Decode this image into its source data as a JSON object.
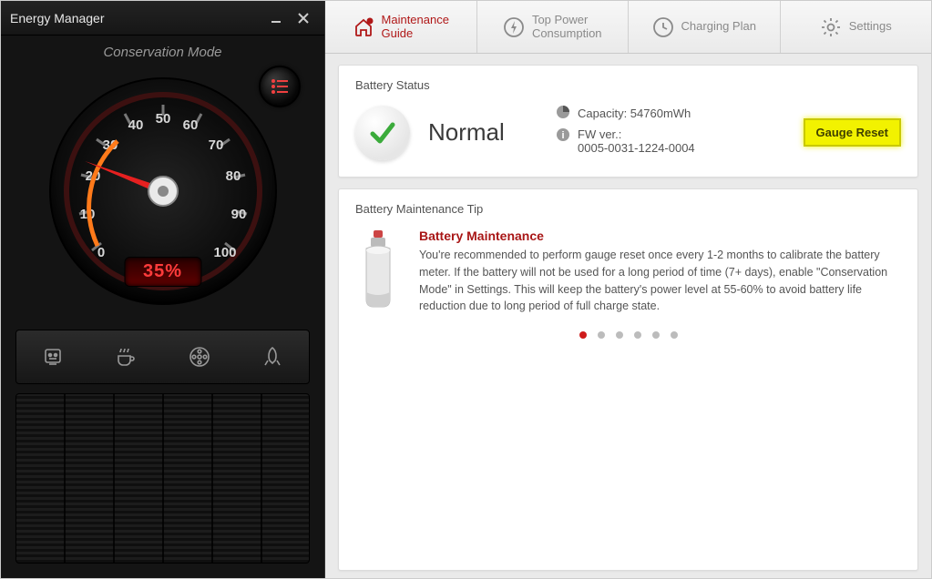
{
  "app": {
    "title": "Energy Manager"
  },
  "mode_label": "Conservation Mode",
  "gauge": {
    "percent_text": "35%",
    "percent_value": 35,
    "ticks": [
      "0",
      "10",
      "20",
      "30",
      "40",
      "50",
      "60",
      "70",
      "80",
      "90",
      "100"
    ]
  },
  "tabs": [
    {
      "label": "Maintenance\nGuide",
      "icon": "home-alert-icon",
      "active": true
    },
    {
      "label": "Top Power\nConsumption",
      "icon": "bolt-icon",
      "active": false
    },
    {
      "label": "Charging Plan",
      "icon": "clock-icon",
      "active": false
    },
    {
      "label": "Settings",
      "icon": "gear-icon",
      "active": false
    }
  ],
  "status": {
    "section_title": "Battery Status",
    "status_text": "Normal",
    "capacity_label": "Capacity: 54760mWh",
    "fw_label": "FW ver.:",
    "fw_value": "0005-0031-1224-0004",
    "reset_button": "Gauge Reset"
  },
  "tip": {
    "section_title": "Battery Maintenance Tip",
    "title": "Battery Maintenance",
    "text": "You're recommended to perform gauge reset once every 1-2 months to calibrate the battery meter. If the battery will not be used for a long period of time (7+ days), enable \"Conservation Mode\" in Settings. This will keep the battery's power level at 55-60% to avoid battery life reduction due to long period of full charge state."
  },
  "pager": {
    "count": 6,
    "active": 0
  }
}
